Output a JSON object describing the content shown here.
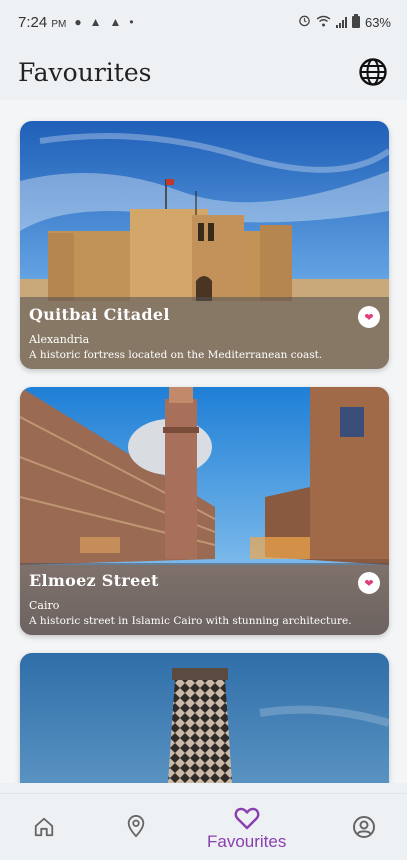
{
  "status_bar": {
    "time": "7:24",
    "ampm": "PM",
    "battery": "63%"
  },
  "header": {
    "title": "Favourites",
    "language_icon": "globe-icon"
  },
  "places": [
    {
      "title": "Quitbai Citadel",
      "city": "Alexandria",
      "description": "A historic fortress located on the Mediterranean coast.",
      "favourited": true
    },
    {
      "title": "Elmoez Street",
      "city": "Cairo",
      "description": "A historic street in Islamic Cairo with stunning architecture.",
      "favourited": true
    },
    {
      "title": "",
      "city": "",
      "description": "",
      "favourited": true
    }
  ],
  "bottom_nav": {
    "items": [
      {
        "icon": "home-icon",
        "label": ""
      },
      {
        "icon": "location-pin-icon",
        "label": ""
      },
      {
        "icon": "heart-icon",
        "label": "Favourites",
        "active": true
      },
      {
        "icon": "profile-icon",
        "label": ""
      }
    ]
  },
  "colors": {
    "accent": "#8a3fb0",
    "heart": "#e0407a",
    "background": "#eef1f4"
  }
}
